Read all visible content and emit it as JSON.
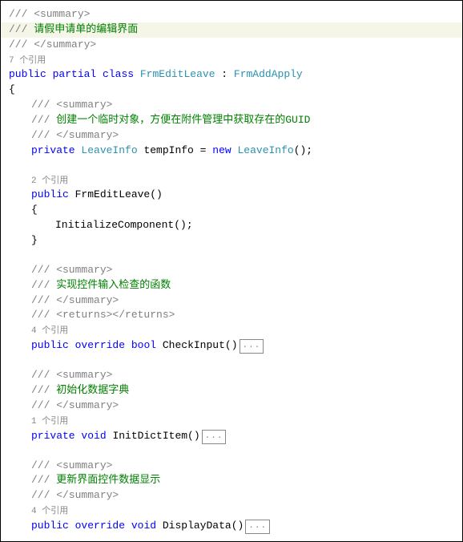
{
  "l1": "/// <summary>",
  "l2a": "/// ",
  "l2b": "请假申请单的编辑界面",
  "l3": "/// </summary>",
  "ref7": "7 个引用",
  "kw_public": "public",
  "kw_partial": "partial",
  "kw_class": "class",
  "cls_FrmEditLeave": "FrmEditLeave",
  "colon": " : ",
  "cls_FrmAddApply": "FrmAddApply",
  "brace_open": "{",
  "brace_close": "}",
  "c_sum_open": "/// <summary>",
  "c_temp_a": "/// ",
  "c_temp_b": "创建一个临时对象，方便在附件管理中获取存在的GUID",
  "c_sum_close": "/// </summary>",
  "kw_private": "private",
  "t_LeaveInfo": "LeaveInfo",
  "v_tempInfo": " tempInfo = ",
  "kw_new": "new",
  "t_LeaveInfo2": "LeaveInfo",
  "paren_semi": "();",
  "ref2": "2 个引用",
  "ctor_name": " FrmEditLeave()",
  "init_call": "InitializeComponent();",
  "c_check_b": "实现控件输入检查的函数",
  "c_returns": "/// <returns></returns>",
  "ref4": "4 个引用",
  "kw_override": "override",
  "t_bool": "bool",
  "m_CheckInput": " CheckInput()",
  "fold": "...",
  "c_init_b": "初始化数据字典",
  "ref1": "1 个引用",
  "t_void": "void",
  "m_InitDictItem": " InitDictItem()",
  "c_disp_b": "更新界面控件数据显示",
  "m_DisplayData": " DisplayData()"
}
